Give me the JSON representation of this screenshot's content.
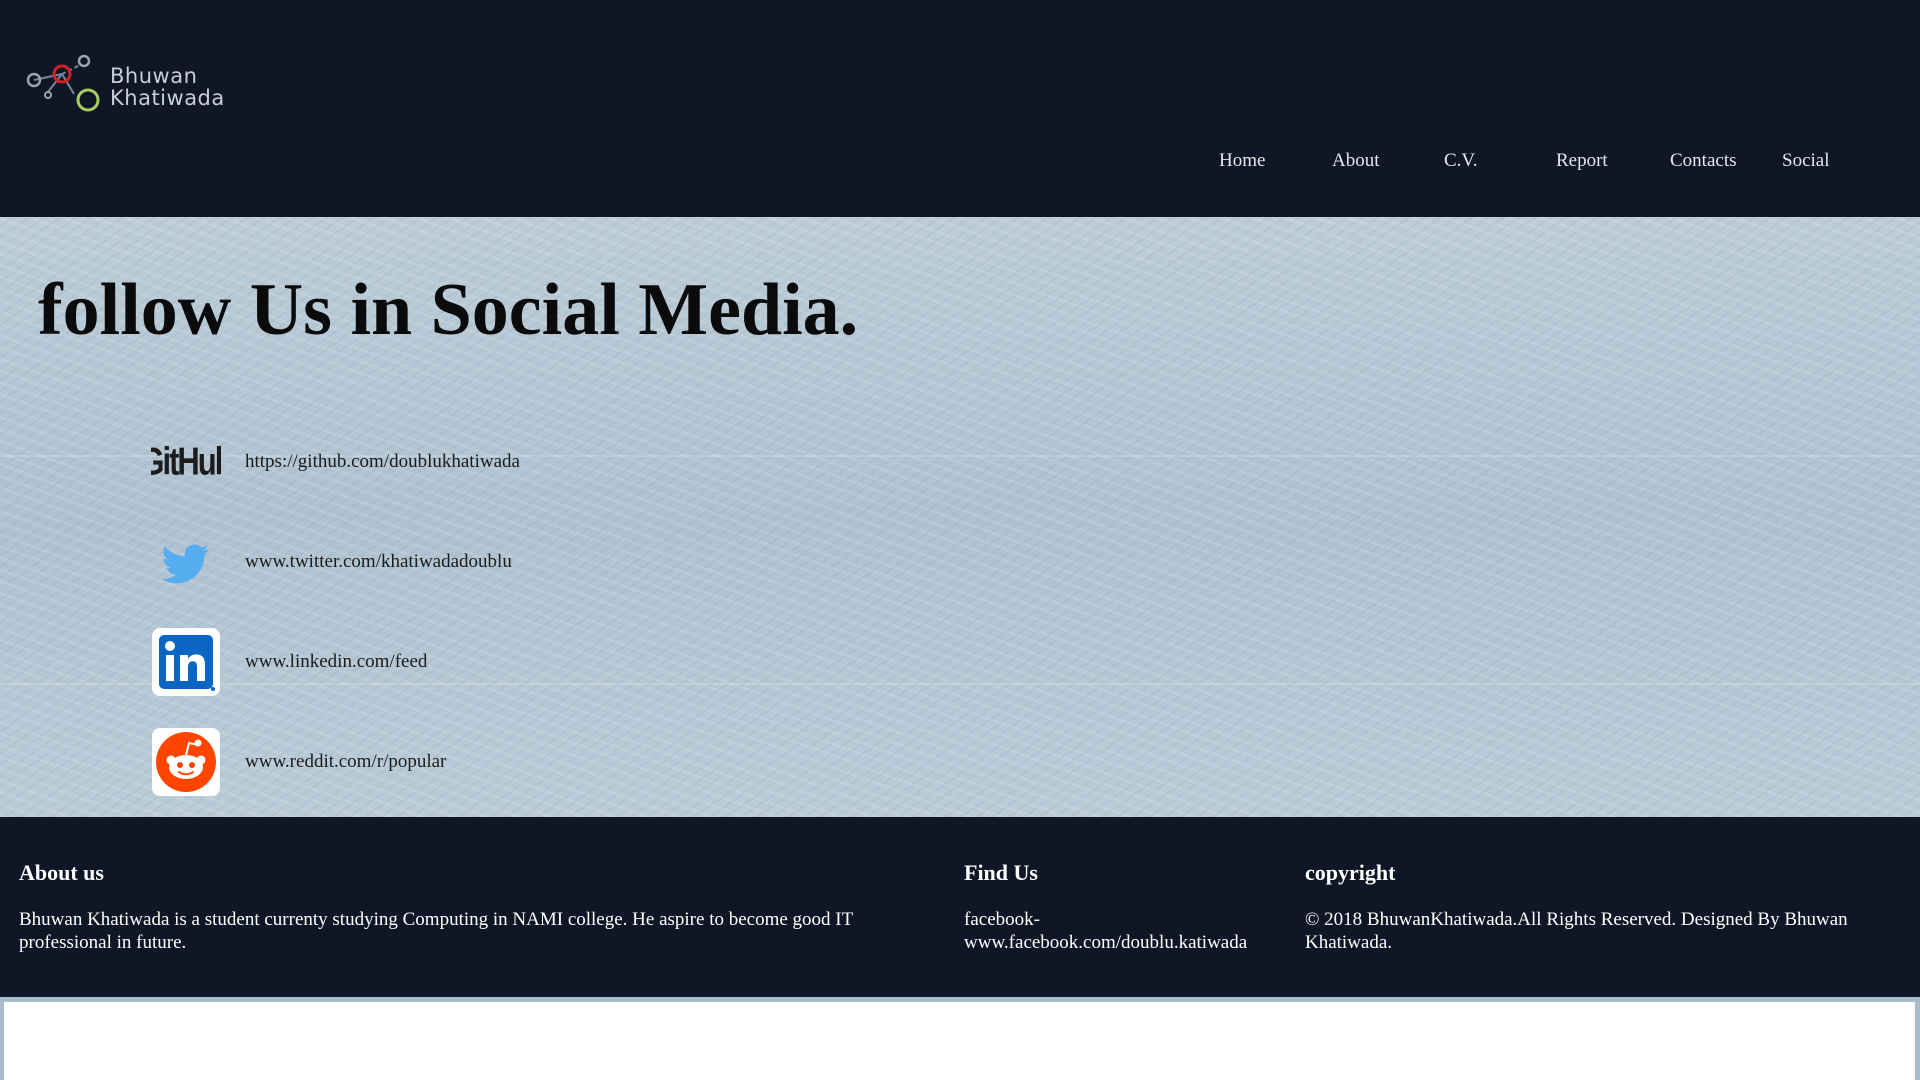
{
  "header": {
    "logo": {
      "line1": "Bhuwan",
      "line2": "Khatiwada"
    },
    "nav": [
      {
        "label": "Home"
      },
      {
        "label": "About"
      },
      {
        "label": "C.V."
      },
      {
        "label": "Report"
      },
      {
        "label": "Contacts"
      },
      {
        "label": "Social"
      }
    ]
  },
  "main": {
    "title": "follow Us in Social Media.",
    "social": [
      {
        "icon": "github-icon",
        "link": "https://github.com/doublukhatiwada"
      },
      {
        "icon": "twitter-icon",
        "link": "www.twitter.com/khatiwadadoublu"
      },
      {
        "icon": "linkedin-icon",
        "link": "www.linkedin.com/feed"
      },
      {
        "icon": "reddit-icon",
        "link": "www.reddit.com/r/popular"
      }
    ]
  },
  "footer": {
    "about": {
      "heading": "About us",
      "text": "Bhuwan Khatiwada is a student currenty studying Computing in NAMI college. He aspire to become good IT professional in future."
    },
    "find": {
      "heading": "Find Us",
      "text": "facebook-www.facebook.com/doublu.katiwada"
    },
    "copyright": {
      "heading": "copyright",
      "text": "© 2018 BhuwanKhatiwada.All Rights Reserved. Designed By Bhuwan Khatiwada."
    }
  },
  "colors": {
    "header_bg": "#0f1726",
    "main_bg": "#b3c6d4",
    "twitter": "#55acee",
    "linkedin": "#0a66c2",
    "reddit": "#ff4500"
  }
}
